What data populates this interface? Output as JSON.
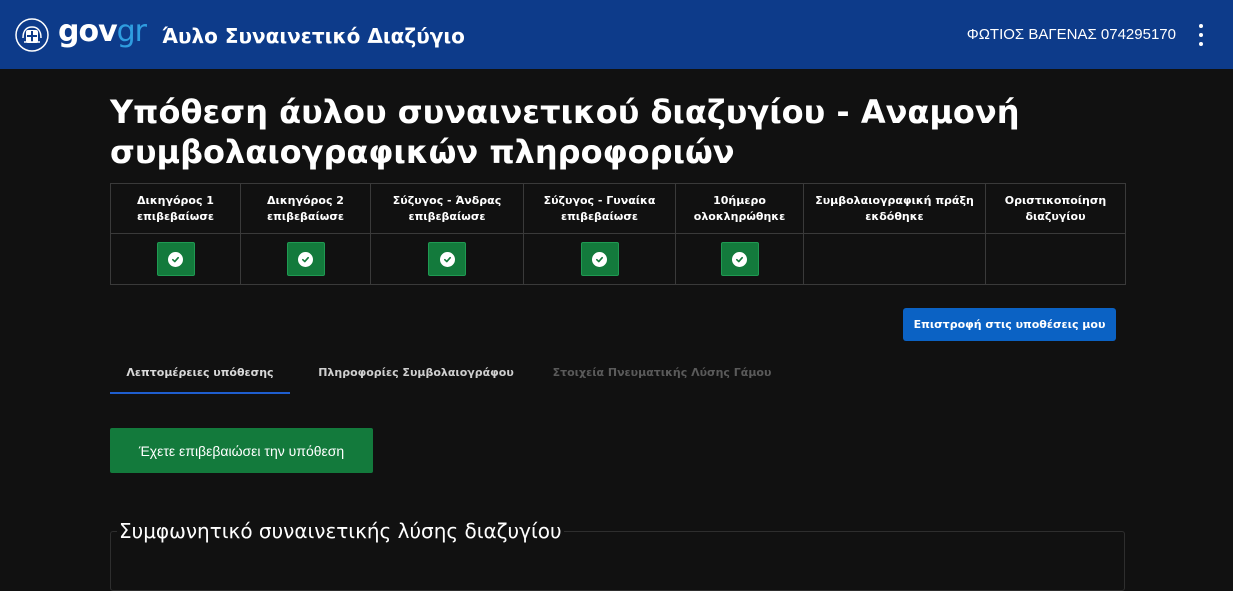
{
  "header": {
    "logo_gov": "gov",
    "logo_gr": "gr",
    "app_title": "Άυλο Συναινετικό Διαζύγιο",
    "user_name": "ΦΩΤΙΟΣ ΒΑΓΕΝΑΣ 074295170",
    "colors": {
      "background": "#0d3b8a",
      "logo_accent": "#2f9de0"
    },
    "icons": {
      "emblem": "greek-emblem-icon",
      "menu": "kebab-menu-icon"
    }
  },
  "page": {
    "title": "Υπόθεση άυλου συναινετικού διαζυγίου - Αναμονή συμβολαιογραφικών πληροφοριών"
  },
  "status_steps": [
    {
      "label": "Δικηγόρος 1 επιβεβαίωσε",
      "done": true
    },
    {
      "label": "Δικηγόρος 2 επιβεβαίωσε",
      "done": true
    },
    {
      "label": "Σύζυγος - Άνδρας επιβεβαίωσε",
      "done": true
    },
    {
      "label": "Σύζυγος - Γυναίκα επιβεβαίωσε",
      "done": true
    },
    {
      "label": "10ήμερο ολοκληρώθηκε",
      "done": true
    },
    {
      "label": "Συμβολαιογραφική πράξη εκδόθηκε",
      "done": false
    },
    {
      "label": "Οριστικοποίηση διαζυγίου",
      "done": false
    }
  ],
  "status_colors": {
    "done_fill": "#137a3c",
    "check": "#ffffff"
  },
  "actions": {
    "back_label": "Επιστροφή στις υποθέσεις μου",
    "confirmed_label": "Έχετε επιβεβαιώσει την υπόθεση",
    "colors": {
      "back": "#0b62c4",
      "confirmed": "#137a3c"
    }
  },
  "tabs": [
    {
      "label": "Λεπτομέρειες υπόθεσης",
      "state": "active"
    },
    {
      "label": "Πληροφορίες Συμβολαιογράφου",
      "state": "normal"
    },
    {
      "label": "Στοιχεία Πνευματικής Λύσης Γάμου",
      "state": "disabled"
    }
  ],
  "agreement": {
    "title": "Συμφωνητικό συναινετικής λύσης διαζυγίου"
  }
}
